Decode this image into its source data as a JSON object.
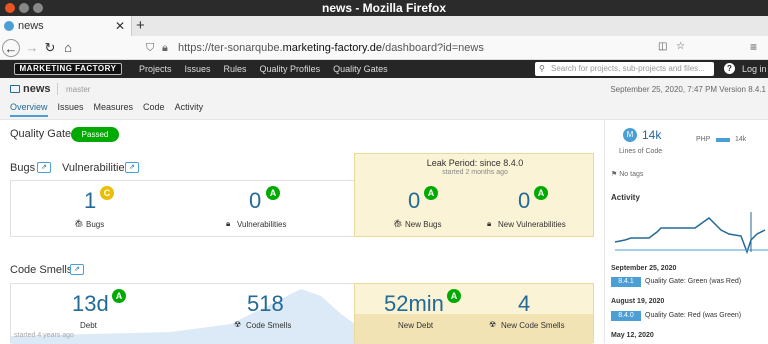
{
  "window": {
    "title": "news - Mozilla Firefox"
  },
  "browser": {
    "tab_title": "news",
    "url_prefix": "https://ter-sonarqube.",
    "url_domain": "marketing-factory.de",
    "url_suffix": "/dashboard?id=news"
  },
  "topnav": {
    "logo": "MARKETING FACTORY",
    "menu": [
      "Projects",
      "Issues",
      "Rules",
      "Quality Profiles",
      "Quality Gates"
    ],
    "search_placeholder": "Search for projects, sub-projects and files...",
    "help": "?",
    "login": "Log in"
  },
  "project": {
    "name": "news",
    "branch": "master",
    "meta": "September 25, 2020, 7:47 PM   Version 8.4.1",
    "tabs": [
      "Overview",
      "Issues",
      "Measures",
      "Code",
      "Activity"
    ]
  },
  "quality_gate": {
    "label": "Quality Gate",
    "status": "Passed"
  },
  "reliability": {
    "bugs_label": "Bugs",
    "vuln_label": "Vulnerabilities",
    "bugs": "1",
    "bugs_rating": "C",
    "vulns": "0",
    "vulns_rating": "A",
    "bugs_caption": "Bugs",
    "vulns_caption": "Vulnerabilities"
  },
  "leak": {
    "title": "Leak Period: since 8.4.0",
    "subtitle": "started 2 months ago",
    "new_bugs": "0",
    "new_bugs_rating": "A",
    "new_bugs_caption": "New Bugs",
    "new_vulns": "0",
    "new_vulns_rating": "A",
    "new_vulns_caption": "New Vulnerabilities"
  },
  "maintainability": {
    "label": "Code Smells",
    "debt": "13d",
    "debt_rating": "A",
    "debt_caption": "Debt",
    "smells": "518",
    "smells_caption": "Code Smells",
    "started": "started 4 years ago",
    "new_debt": "52min",
    "new_debt_rating": "A",
    "new_debt_caption": "New Debt",
    "new_smells": "4",
    "new_smells_caption": "New Code Smells"
  },
  "sidebar": {
    "loc_icon": "M",
    "loc": "14k",
    "loc_label": "Lines of Code",
    "lang": "PHP",
    "lang_count": "14k",
    "tags": "No tags",
    "activity_title": "Activity",
    "events": [
      {
        "date": "September 25, 2020",
        "version": "8.4.1",
        "text": "Quality Gate: Green (was Red)"
      },
      {
        "date": "August 19, 2020",
        "version": "8.4.0",
        "text": "Quality Gate: Red (was Green)"
      },
      {
        "date": "May 12, 2020"
      }
    ]
  },
  "colors": {
    "accent": "#4b9fd5",
    "link": "#236a97",
    "passed": "#00aa00",
    "rating_a": "#00aa00",
    "rating_c": "#eabe06",
    "leak_bg": "#fbf3d5"
  }
}
